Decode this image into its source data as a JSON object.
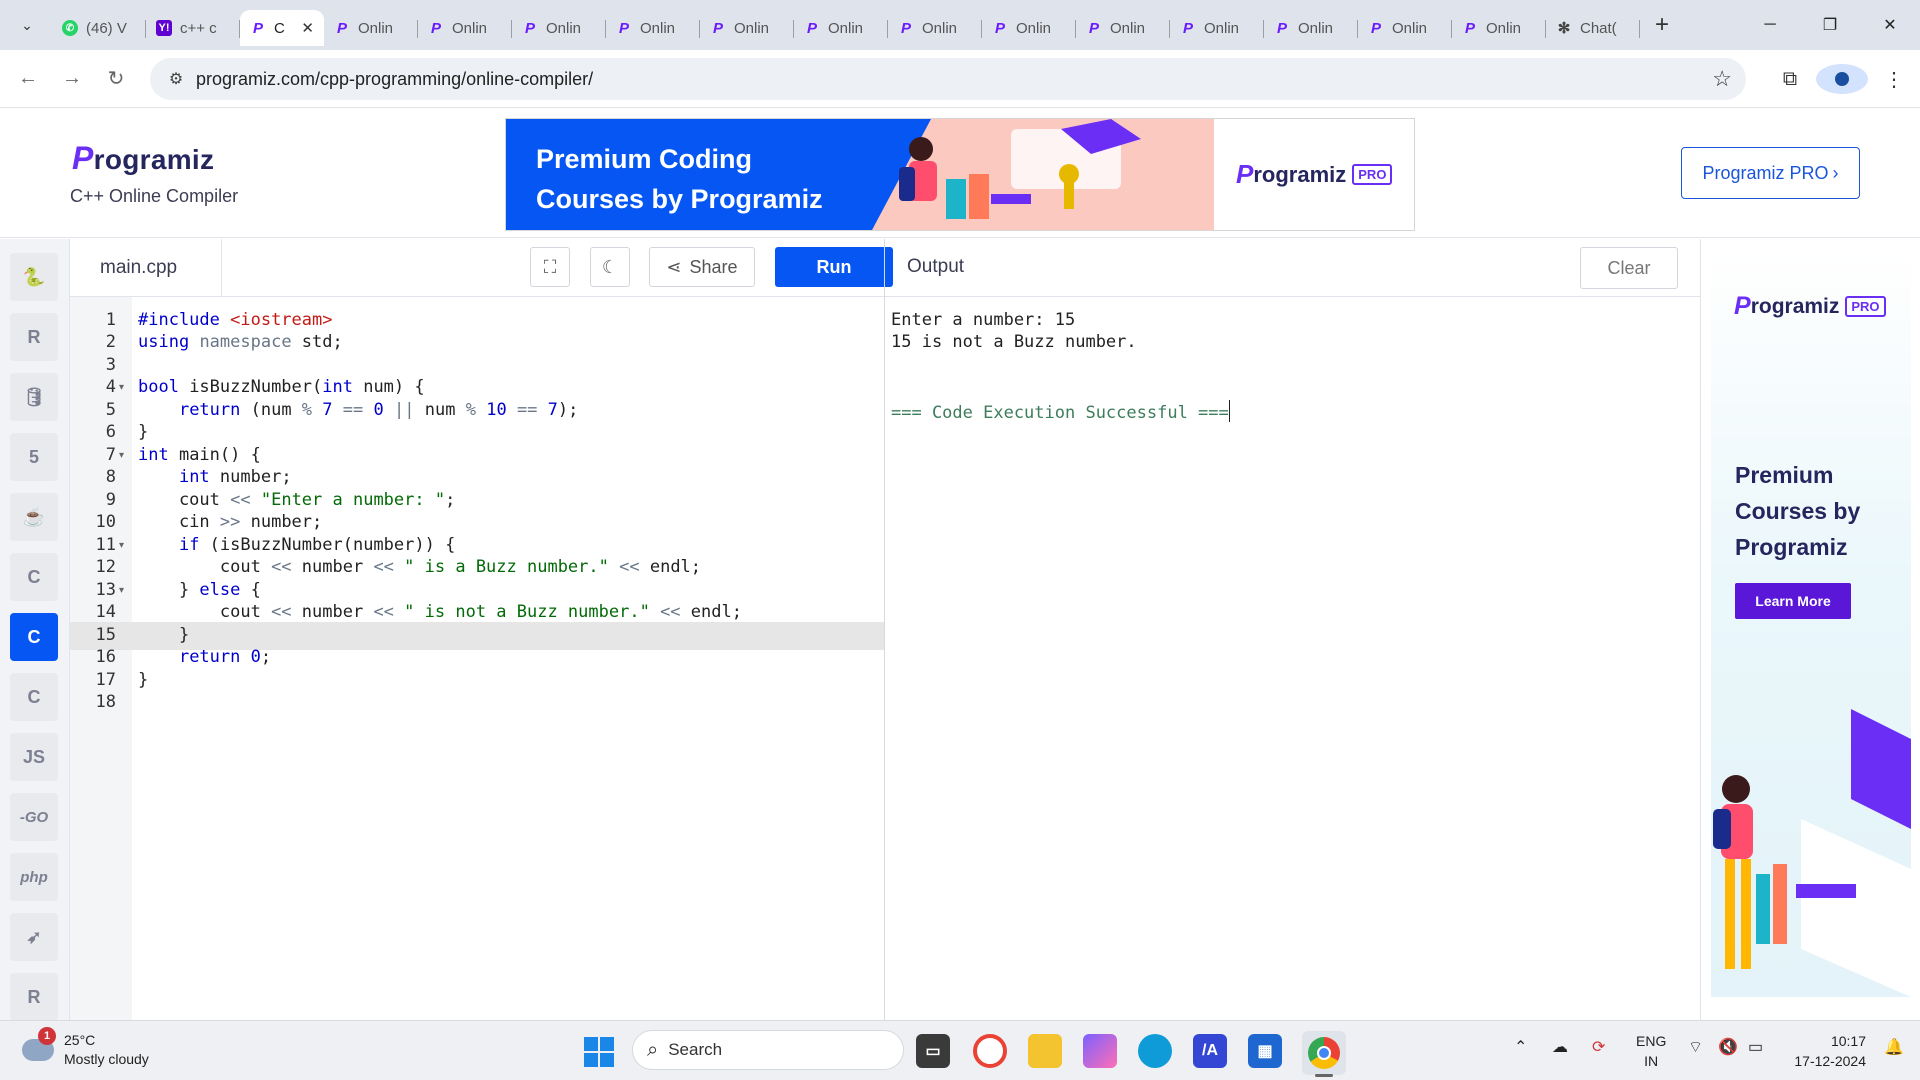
{
  "browser": {
    "tabs": [
      {
        "icon": "whatsapp-icon",
        "title": "(46) V"
      },
      {
        "icon": "yahoo-icon",
        "title": "c++ c"
      },
      {
        "icon": "programiz-icon",
        "title": "C",
        "active": true
      },
      {
        "icon": "programiz-icon",
        "title": "Onlin"
      },
      {
        "icon": "programiz-icon",
        "title": "Onlin"
      },
      {
        "icon": "programiz-icon",
        "title": "Onlin"
      },
      {
        "icon": "programiz-icon",
        "title": "Onlin"
      },
      {
        "icon": "programiz-icon",
        "title": "Onlin"
      },
      {
        "icon": "programiz-icon",
        "title": "Onlin"
      },
      {
        "icon": "programiz-icon",
        "title": "Onlin"
      },
      {
        "icon": "programiz-icon",
        "title": "Onlin"
      },
      {
        "icon": "programiz-icon",
        "title": "Onlin"
      },
      {
        "icon": "programiz-icon",
        "title": "Onlin"
      },
      {
        "icon": "programiz-icon",
        "title": "Onlin"
      },
      {
        "icon": "programiz-icon",
        "title": "Onlin"
      },
      {
        "icon": "programiz-icon",
        "title": "Onlin"
      },
      {
        "icon": "chatgpt-icon",
        "title": "Chat("
      }
    ],
    "url": "programiz.com/cpp-programming/online-compiler/"
  },
  "header": {
    "logo": "rogramiz",
    "logo_mark": "P",
    "subtitle": "C++ Online Compiler",
    "banner_text_line1": "Premium Coding",
    "banner_text_line2": "Courses by Programiz",
    "banner_logo": "rogramiz",
    "banner_logo_mark": "P",
    "banner_pro": "PRO",
    "pro_button": "Programiz PRO"
  },
  "rail": {
    "items": [
      {
        "name": "python-icon",
        "glyph": "🐍"
      },
      {
        "name": "r-icon",
        "glyph": "R"
      },
      {
        "name": "sql-icon",
        "glyph": "🛢"
      },
      {
        "name": "html-icon",
        "glyph": "5"
      },
      {
        "name": "java-icon",
        "glyph": "☕"
      },
      {
        "name": "c-icon",
        "glyph": "C"
      },
      {
        "name": "cpp-icon",
        "glyph": "C",
        "active": true
      },
      {
        "name": "csharp-icon",
        "glyph": "C"
      },
      {
        "name": "js-icon",
        "glyph": "JS"
      },
      {
        "name": "go-icon",
        "glyph": "-GO"
      },
      {
        "name": "php-icon",
        "glyph": "php"
      },
      {
        "name": "swift-icon",
        "glyph": "➶"
      },
      {
        "name": "rust-icon",
        "glyph": "R"
      }
    ]
  },
  "editor": {
    "filename": "main.cpp",
    "share_label": "Share",
    "run_label": "Run",
    "active_line": 15,
    "lines": [
      "#include <iostream>",
      "using namespace std;",
      "",
      "bool isBuzzNumber(int num) {",
      "    return (num % 7 == 0 || num % 10 == 7);",
      "}",
      "int main() {",
      "    int number;",
      "    cout << \"Enter a number: \";",
      "    cin >> number;",
      "    if (isBuzzNumber(number)) {",
      "        cout << number << \" is a Buzz number.\" << endl;",
      "    } else {",
      "        cout << number << \" is not a Buzz number.\" << endl;",
      "    }",
      "    return 0;",
      "}",
      ""
    ],
    "fold_lines": [
      4,
      7,
      11,
      13
    ]
  },
  "output": {
    "title": "Output",
    "clear_label": "Clear",
    "lines": [
      "Enter a number: 15",
      "15 is not a Buzz number.",
      "",
      "",
      "=== Code Execution Successful ==="
    ]
  },
  "side_ad": {
    "logo": "rogramiz",
    "logo_mark": "P",
    "pro": "PRO",
    "headline_1": "Premium",
    "headline_2": "Courses by",
    "headline_3": "Programiz",
    "button": "Learn More"
  },
  "taskbar": {
    "weather_temp": "25°C",
    "weather_desc": "Mostly cloudy",
    "weather_badge": "1",
    "search_placeholder": "Search",
    "lang_1": "ENG",
    "lang_2": "IN",
    "time": "10:17",
    "date": "17-12-2024"
  },
  "colors": {
    "brand_blue": "#0556f3",
    "brand_purple": "#6b2ef5",
    "keyword": "#0000cc",
    "string": "#036a07"
  }
}
